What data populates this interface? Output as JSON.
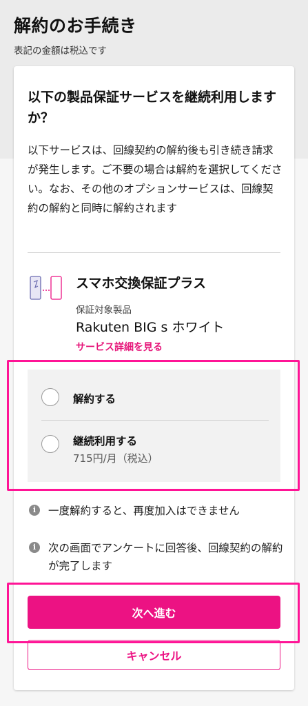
{
  "header": {
    "title": "解約のお手続き",
    "subtitle": "表記の金額は税込です"
  },
  "question": {
    "title": "以下の製品保証サービスを継続利用しますか？",
    "description": "以下サービスは、回線契約の解約後も引き続き請求が発生します。ご不要の場合は解約を選択してください。なお、その他のオプションサービスは、回線契約の解約と同時に解約されます"
  },
  "service": {
    "icon": "phone-exchange-icon",
    "name": "スマホ交換保証プラス",
    "target_label": "保証対象製品",
    "product": "Rakuten BIG s ホワイト",
    "detail_link": "サービス詳細を見る"
  },
  "options": [
    {
      "label": "解約する",
      "price": "",
      "selected": false
    },
    {
      "label": "継続利用する",
      "price": "715円/月（税込）",
      "selected": false
    }
  ],
  "notes": [
    {
      "icon": "info-icon",
      "text": "一度解約すると、再度加入はできません"
    },
    {
      "icon": "info-icon",
      "text": "次の画面でアンケートに回答後、回線契約の解約が完了します"
    }
  ],
  "actions": {
    "next_label": "次へ進む",
    "cancel_label": "キャンセル"
  },
  "colors": {
    "accent": "#ec1283",
    "highlight": "#ff1496"
  }
}
